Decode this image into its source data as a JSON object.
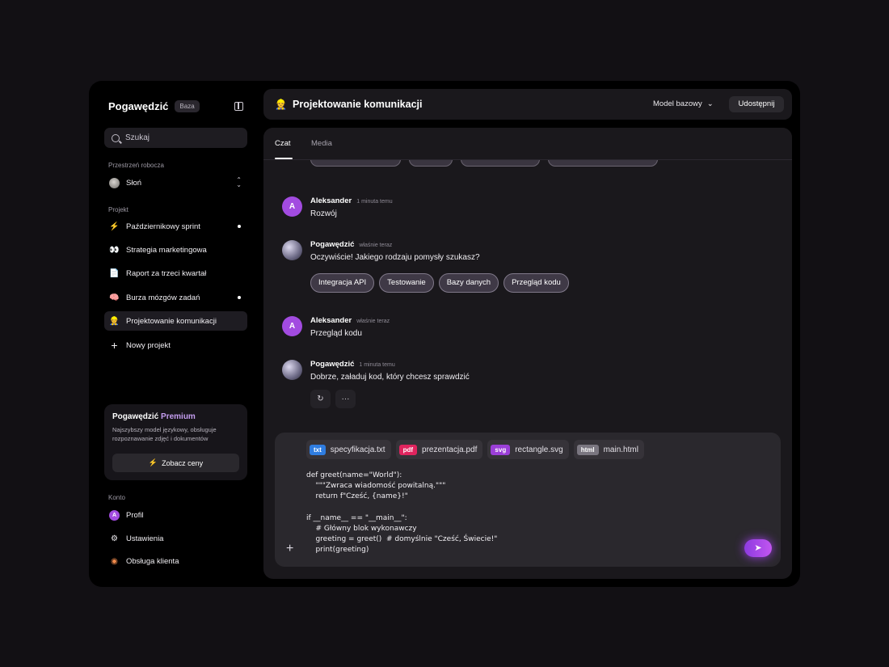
{
  "sidebar": {
    "brand": "Pogawędzić",
    "brand_badge": "Baza",
    "search_placeholder": "Szukaj",
    "workspace_label": "Przestrzeń robocza",
    "workspace_name": "Słoń",
    "project_label": "Projekt",
    "projects": [
      {
        "label": "Październikowy sprint",
        "icon": "⚡",
        "dot": true
      },
      {
        "label": "Strategia marketingowa",
        "icon": "👀",
        "dot": false
      },
      {
        "label": "Raport za trzeci kwartał",
        "icon": "📄",
        "dot": false
      },
      {
        "label": "Burza mózgów zadań",
        "icon": "🧠",
        "dot": true
      },
      {
        "label": "Projektowanie komunikacji",
        "icon": "👷",
        "dot": false
      }
    ],
    "new_project": "Nowy projekt",
    "premium": {
      "title_a": "Pogawędzić",
      "title_b": "Premium",
      "description": "Najszybszy model językowy, obsługuje rozpoznawanie zdjęć i dokumentów",
      "button": "Zobacz ceny"
    },
    "account_label": "Konto",
    "account": [
      {
        "label": "Profil"
      },
      {
        "label": "Ustawienia"
      },
      {
        "label": "Obsługa klienta"
      }
    ],
    "profile_initial": "A"
  },
  "header": {
    "title": "Projektowanie komunikacji",
    "icon": "👷",
    "model": "Model bazowy",
    "share": "Udostępnij"
  },
  "tabs": [
    {
      "label": "Czat"
    },
    {
      "label": "Media"
    }
  ],
  "messages": [
    {
      "author": "Aleksander",
      "time": "1 minuta temu",
      "text": "Rozwój",
      "initial": "A"
    },
    {
      "author": "Pogawędzić",
      "time": "właśnie teraz",
      "text": "Oczywiście! Jakiego rodzaju pomysły szukasz?"
    },
    {
      "author": "Aleksander",
      "time": "właśnie teraz",
      "text": "Przegląd kodu",
      "initial": "A"
    },
    {
      "author": "Pogawędzić",
      "time": "1 minuta temu",
      "text": "Dobrze, załaduj kod, który chcesz sprawdzić"
    }
  ],
  "suggestions": [
    "Integracja API",
    "Testowanie",
    "Bazy danych",
    "Przegląd kodu"
  ],
  "composer": {
    "attachments": [
      {
        "tag": "txt",
        "name": "specyfikacja.txt",
        "color": "#2f7de1"
      },
      {
        "tag": "pdf",
        "name": "prezentacja.pdf",
        "color": "#e0245e"
      },
      {
        "tag": "svg",
        "name": "rectangle.svg",
        "color": "#9b3fd8"
      },
      {
        "tag": "html",
        "name": "main.html",
        "color": "#7a7680"
      }
    ],
    "code": "def greet(name=\"World\"):\n    \"\"\"Zwraca wiadomość powitalną.\"\"\"\n    return f\"Cześć, {name}!\"\n\nif __name__ == \"__main__\":\n    # Główny blok wykonawczy\n    greeting = greet()  # domyślnie \"Cześć, Świecie!\"\n    print(greeting)"
  },
  "colors": {
    "accent": "#a24be0",
    "background": "#000000",
    "panel": "#1a181c"
  }
}
